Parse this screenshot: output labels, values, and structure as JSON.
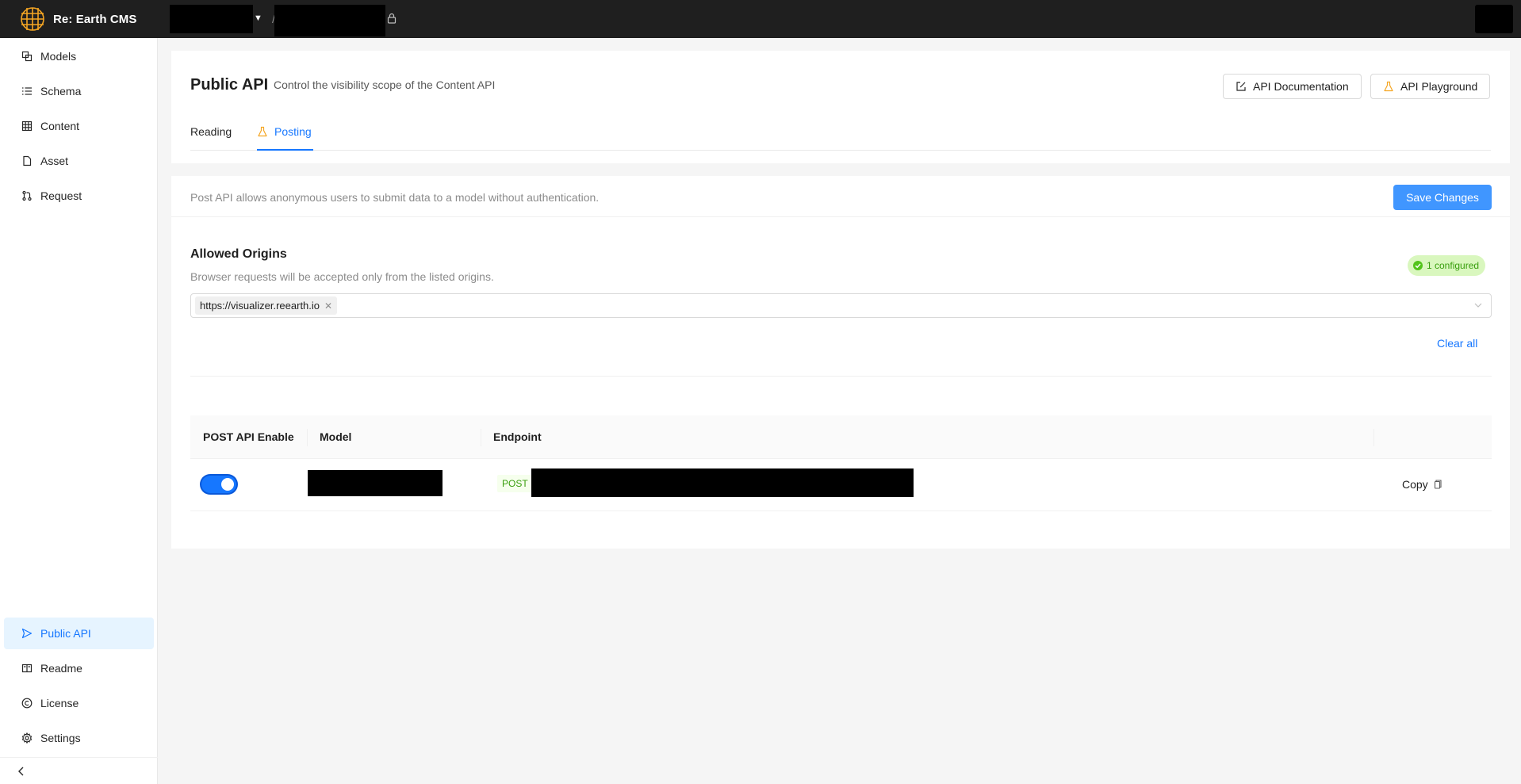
{
  "app": {
    "name": "Re: Earth CMS"
  },
  "sidebar": {
    "items": [
      {
        "label": "Models",
        "icon": "models-icon"
      },
      {
        "label": "Schema",
        "icon": "schema-icon"
      },
      {
        "label": "Content",
        "icon": "content-icon"
      },
      {
        "label": "Asset",
        "icon": "asset-icon"
      },
      {
        "label": "Request",
        "icon": "request-icon"
      }
    ],
    "bottom_items": [
      {
        "label": "Public API",
        "icon": "send-icon",
        "active": true
      },
      {
        "label": "Readme",
        "icon": "book-icon"
      },
      {
        "label": "License",
        "icon": "copyright-icon"
      },
      {
        "label": "Settings",
        "icon": "gear-icon"
      }
    ]
  },
  "page": {
    "title": "Public API",
    "subtitle": "Control the visibility scope of the Content API",
    "doc_button": "API Documentation",
    "playground_button": "API Playground",
    "tabs": [
      {
        "label": "Reading",
        "active": false
      },
      {
        "label": "Posting",
        "active": true
      }
    ]
  },
  "posting": {
    "description": "Post API allows anonymous users to submit data to a model without authentication.",
    "save_button": "Save Changes",
    "origins": {
      "title": "Allowed Origins",
      "subtitle": "Browser requests will be accepted only from the listed origins.",
      "badge": "1 configured",
      "tags": [
        "https://visualizer.reearth.io"
      ],
      "clear_all": "Clear all"
    },
    "table": {
      "columns": [
        "POST API Enable",
        "Model",
        "Endpoint"
      ],
      "rows": [
        {
          "enabled": true,
          "method": "POST",
          "copy_label": "Copy"
        }
      ]
    }
  },
  "colors": {
    "primary": "#1677ff",
    "header_bg": "#1f1f1f",
    "success": "#389e0d",
    "logo": "#f5a623"
  }
}
